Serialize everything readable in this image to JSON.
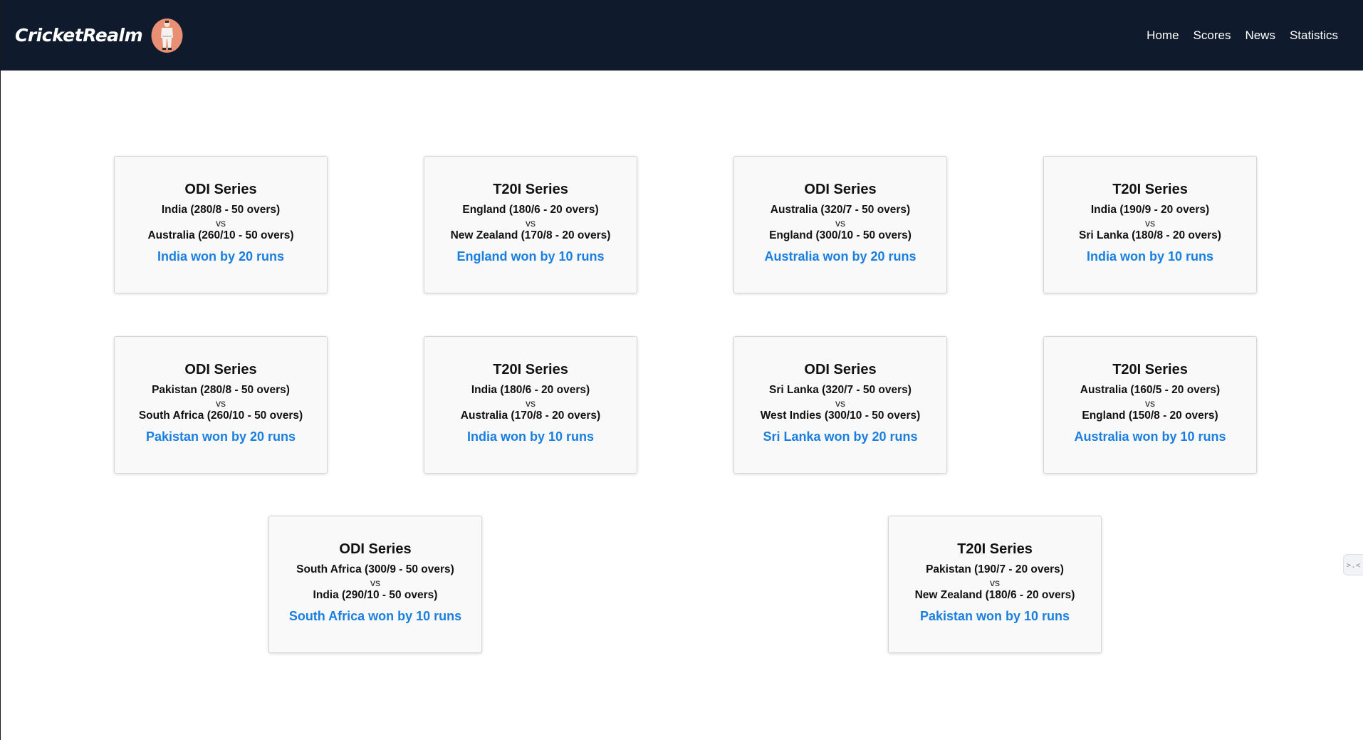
{
  "header": {
    "brand": "CricketRealm",
    "logo_icon": "cricketer-logo-icon",
    "nav": [
      "Home",
      "Scores",
      "News",
      "Statistics"
    ]
  },
  "matches": [
    {
      "series": "ODI Series",
      "team1": "India (280/8 - 50 overs)",
      "vs": "vs",
      "team2": "Australia (260/10 - 50 overs)",
      "result": "India won by 20 runs"
    },
    {
      "series": "T20I Series",
      "team1": "England (180/6 - 20 overs)",
      "vs": "vs",
      "team2": "New Zealand (170/8 - 20 overs)",
      "result": "England won by 10 runs"
    },
    {
      "series": "ODI Series",
      "team1": "Australia (320/7 - 50 overs)",
      "vs": "vs",
      "team2": "England (300/10 - 50 overs)",
      "result": "Australia won by 20 runs"
    },
    {
      "series": "T20I Series",
      "team1": "India (190/9 - 20 overs)",
      "vs": "vs",
      "team2": "Sri Lanka (180/8 - 20 overs)",
      "result": "India won by 10 runs"
    },
    {
      "series": "ODI Series",
      "team1": "Pakistan (280/8 - 50 overs)",
      "vs": "vs",
      "team2": "South Africa (260/10 - 50 overs)",
      "result": "Pakistan won by 20 runs"
    },
    {
      "series": "T20I Series",
      "team1": "India (180/6 - 20 overs)",
      "vs": "vs",
      "team2": "Australia (170/8 - 20 overs)",
      "result": "India won by 10 runs"
    },
    {
      "series": "ODI Series",
      "team1": "Sri Lanka (320/7 - 50 overs)",
      "vs": "vs",
      "team2": "West Indies (300/10 - 50 overs)",
      "result": "Sri Lanka won by 20 runs"
    },
    {
      "series": "T20I Series",
      "team1": "Australia (160/5 - 20 overs)",
      "vs": "vs",
      "team2": "England (150/8 - 20 overs)",
      "result": "Australia won by 10 runs"
    },
    {
      "series": "ODI Series",
      "team1": "South Africa (300/9 - 50 overs)",
      "vs": "vs",
      "team2": "India (290/10 - 50 overs)",
      "result": "South Africa won by 10 runs"
    },
    {
      "series": "T20I Series",
      "team1": "Pakistan (190/7 - 20 overs)",
      "vs": "vs",
      "team2": "New Zealand (180/6 - 20 overs)",
      "result": "Pakistan won by 10 runs"
    }
  ],
  "side_tab": {
    "icon": "collapse-icon",
    "glyph": ">.<"
  },
  "colors": {
    "navbar": "#0f1b2d",
    "result": "#1a7fe0",
    "card_bg": "#f9f9f9"
  }
}
